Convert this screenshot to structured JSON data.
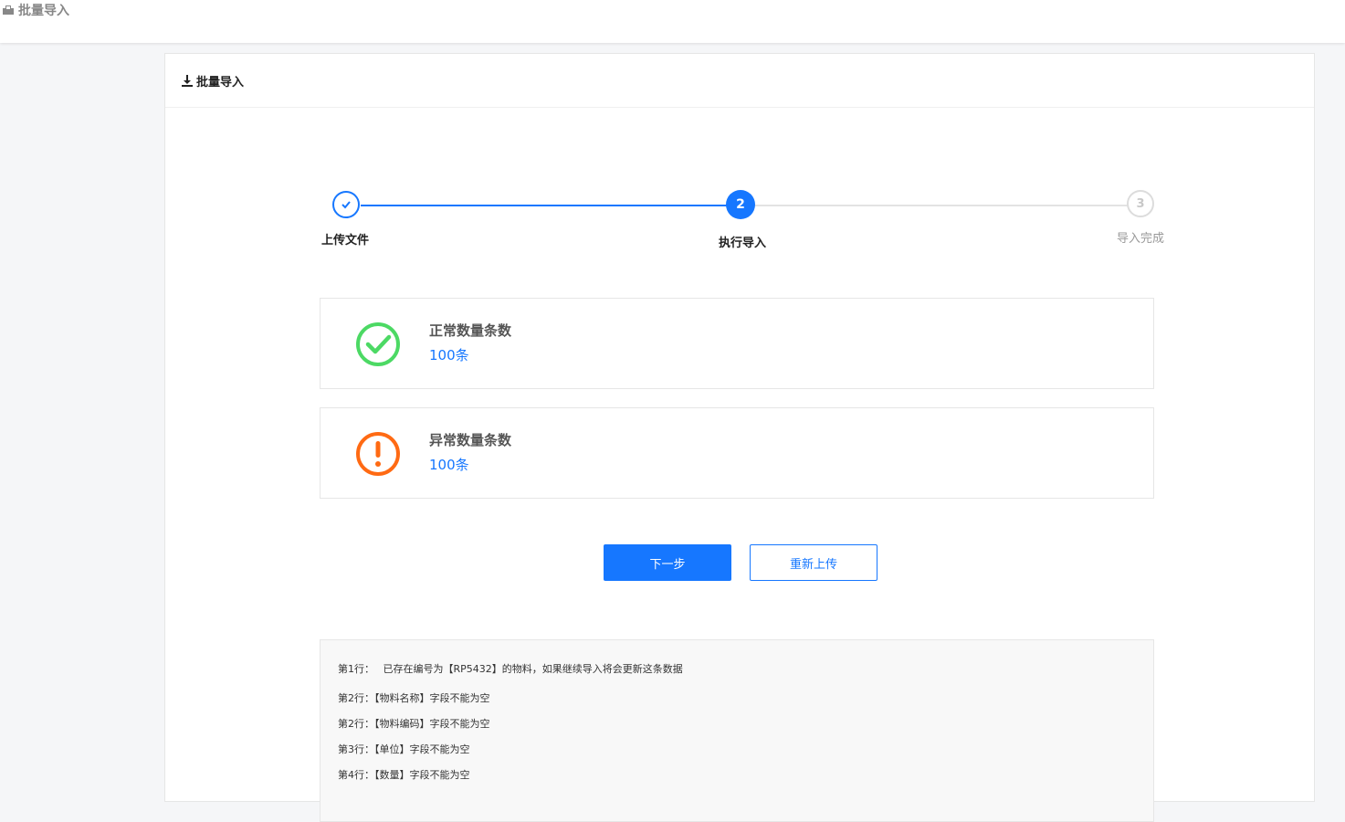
{
  "app": {
    "title": "批量导入"
  },
  "panel": {
    "title": "批量导入"
  },
  "steps": [
    {
      "number": "1",
      "label": "上传文件",
      "state": "finished"
    },
    {
      "number": "2",
      "label": "执行导入",
      "state": "active"
    },
    {
      "number": "3",
      "label": "导入完成",
      "state": "pending"
    }
  ],
  "stats": {
    "normal": {
      "title": "正常数量条数",
      "value": "100条",
      "icon": "check-circle-icon",
      "color": "#4cd964"
    },
    "abnormal": {
      "title": "异常数量条数",
      "value": "100条",
      "icon": "exclamation-circle-icon",
      "color": "#ff6a13"
    }
  },
  "buttons": {
    "next_label": "下一步",
    "reupload_label": "重新上传"
  },
  "errors": [
    {
      "line": "第1行：",
      "message": " 已存在编号为【RP5432】的物料，如果继续导入将会更新这条数据"
    },
    {
      "line": "第2行：",
      "message": "【物料名称】字段不能为空"
    },
    {
      "line": "第2行：",
      "message": "【物料编码】字段不能为空"
    },
    {
      "line": "第3行：",
      "message": "【单位】字段不能为空"
    },
    {
      "line": "第4行：",
      "message": "【数量】字段不能为空"
    }
  ],
  "colors": {
    "accent": "#1677ff",
    "success": "#4cd964",
    "warning": "#ff6a13"
  }
}
